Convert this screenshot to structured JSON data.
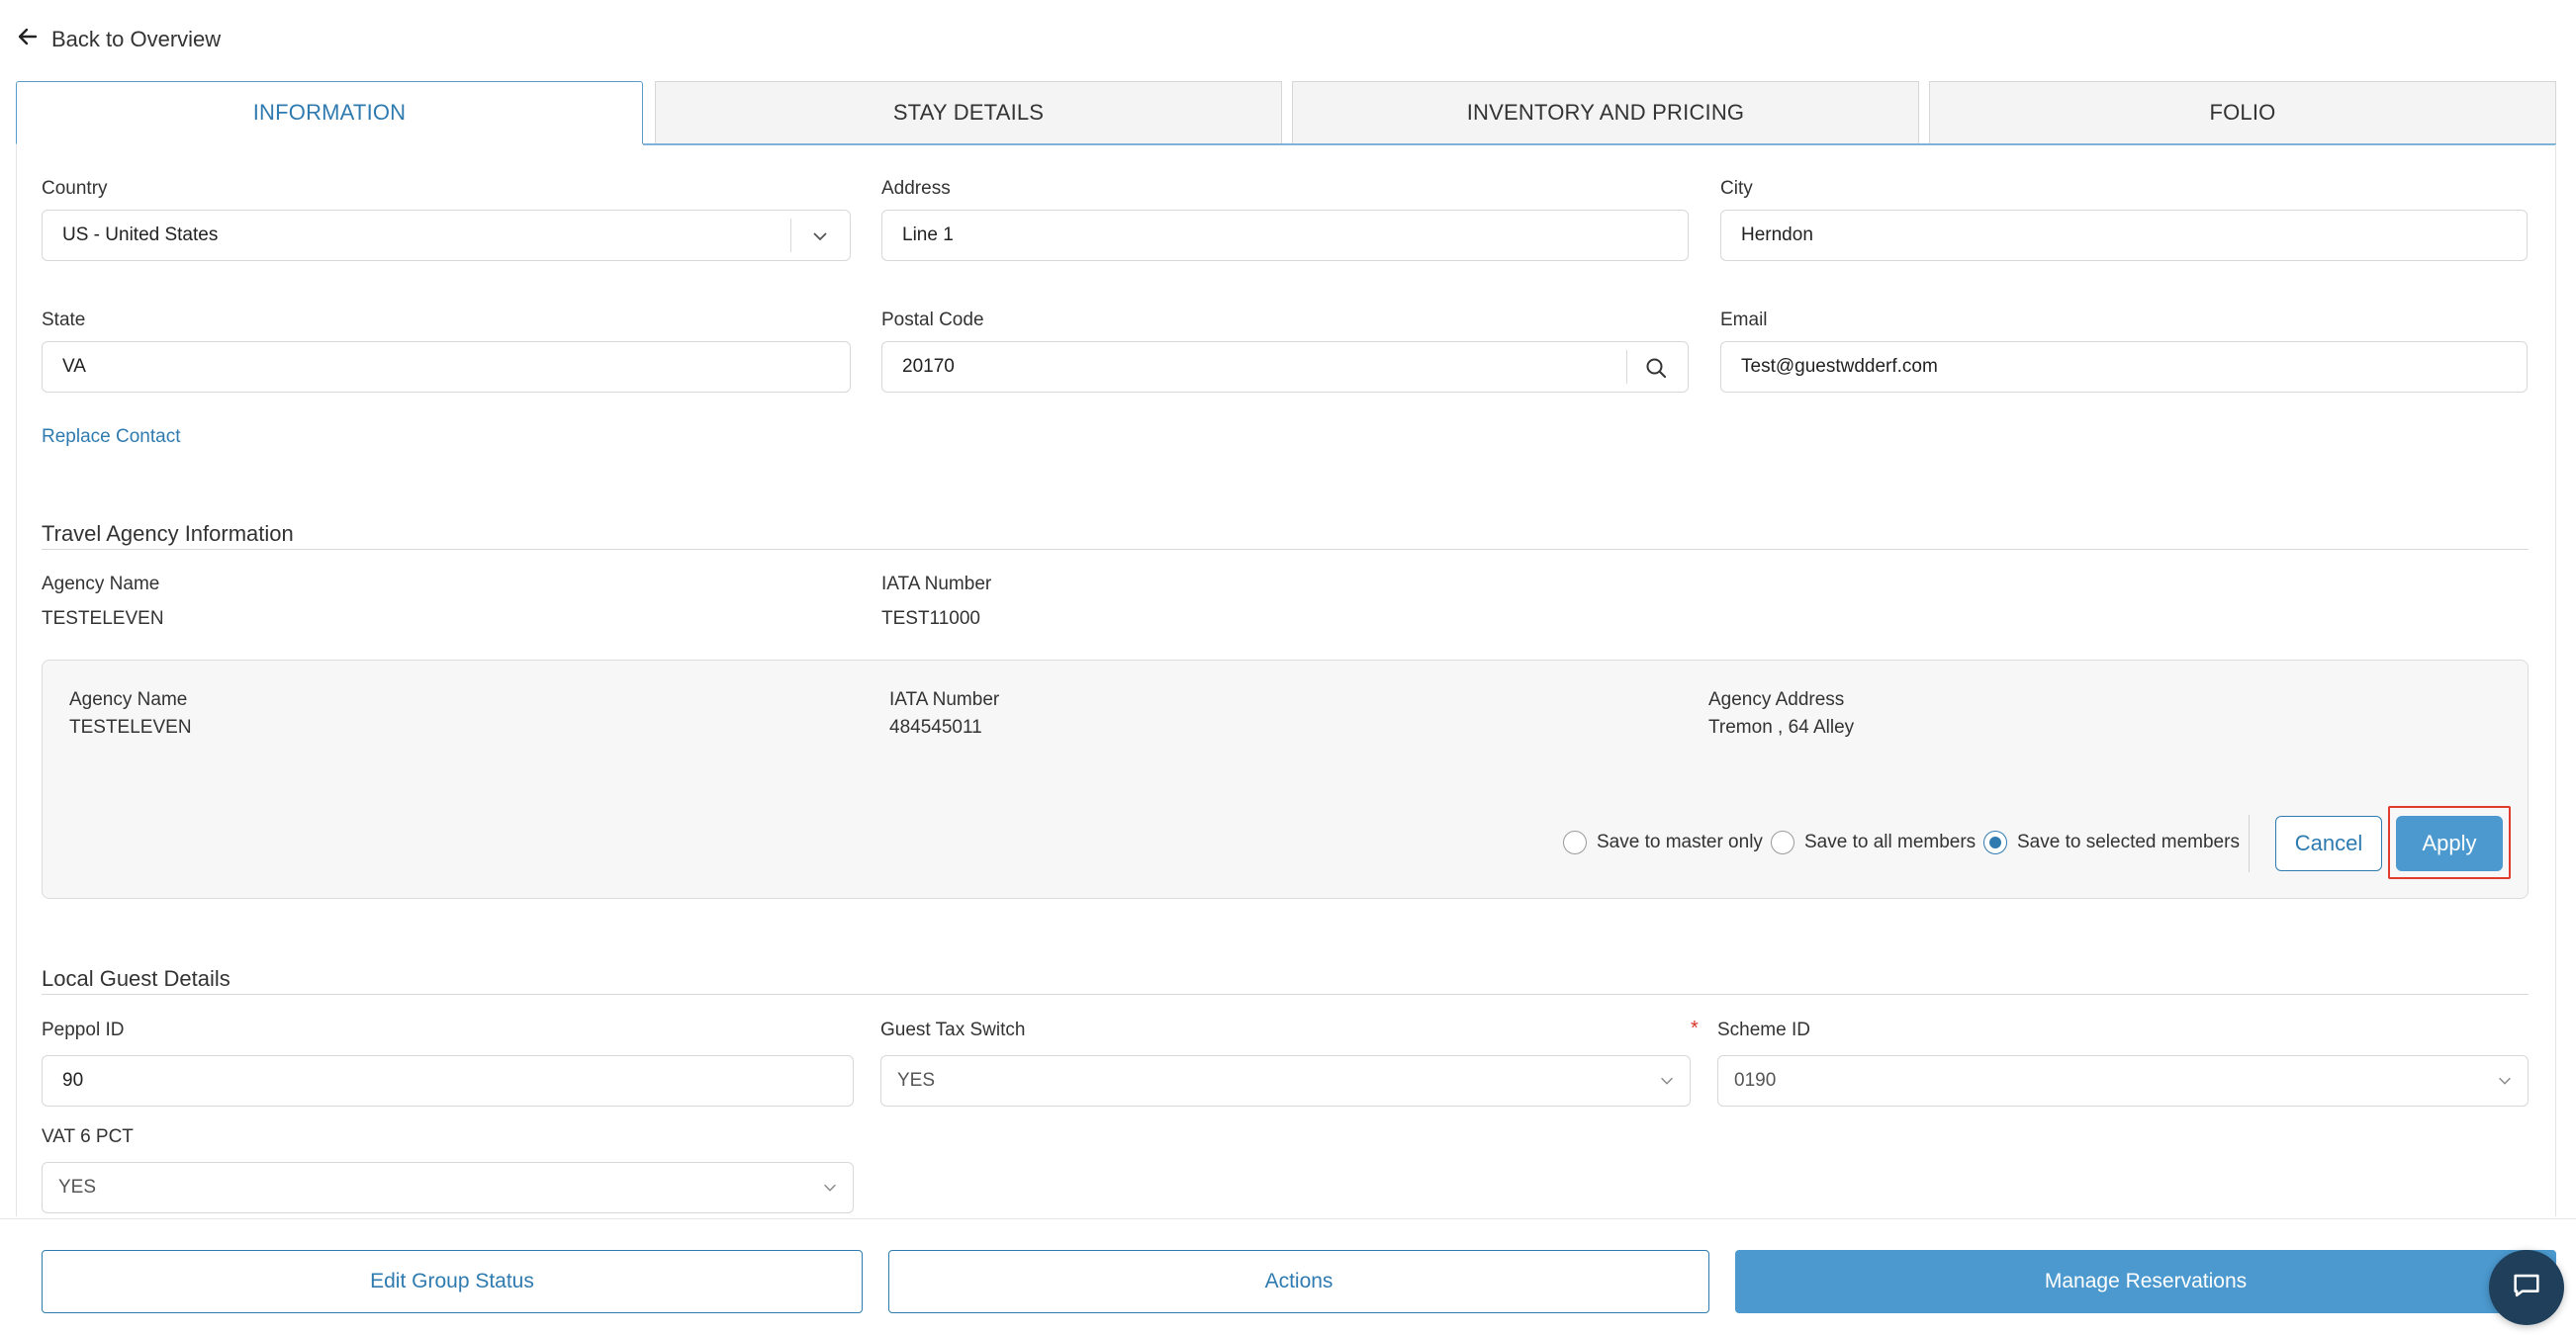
{
  "nav": {
    "back_label": "Back to Overview"
  },
  "tabs": [
    {
      "label": "INFORMATION",
      "active": true
    },
    {
      "label": "STAY DETAILS",
      "active": false
    },
    {
      "label": "INVENTORY AND PRICING",
      "active": false
    },
    {
      "label": "FOLIO",
      "active": false
    }
  ],
  "contact": {
    "country": {
      "label": "Country",
      "value": "US - United States"
    },
    "address": {
      "label": "Address",
      "value": "Line 1"
    },
    "city": {
      "label": "City",
      "value": "Herndon"
    },
    "state": {
      "label": "State",
      "value": "VA"
    },
    "postal_code": {
      "label": "Postal Code",
      "value": "20170"
    },
    "email": {
      "label": "Email",
      "value": "Test@guestwdderf.com"
    },
    "replace_contact": "Replace Contact"
  },
  "travel_agency": {
    "title": "Travel Agency Information",
    "agency_name_label": "Agency Name",
    "agency_name": "TESTELEVEN",
    "iata_label": "IATA Number",
    "iata": "TEST11000",
    "card": {
      "agency_name_label": "Agency Name",
      "agency_name": "TESTELEVEN",
      "iata_label": "IATA Number",
      "iata": "484545011",
      "address_label": "Agency Address",
      "address": "Tremon , 64 Alley"
    },
    "save_options": [
      {
        "label": "Save to master only",
        "selected": false
      },
      {
        "label": "Save to all members",
        "selected": false
      },
      {
        "label": "Save to selected members",
        "selected": true
      }
    ],
    "cancel_label": "Cancel",
    "apply_label": "Apply"
  },
  "local_guest": {
    "title": "Local Guest Details",
    "peppol": {
      "label": "Peppol ID",
      "value": "90"
    },
    "guest_tax": {
      "label": "Guest Tax Switch",
      "value": "YES"
    },
    "scheme": {
      "label": "Scheme ID",
      "required_mark": "*",
      "value": "0190"
    },
    "vat": {
      "label": "VAT 6 PCT",
      "value": "YES"
    }
  },
  "footer": {
    "edit_group_status": "Edit Group Status",
    "actions": "Actions",
    "manage_reservations": "Manage Reservations"
  },
  "icons": {
    "back": "arrow-left-icon",
    "dropdown": "chevron-down-icon",
    "search": "search-icon",
    "chat": "chat-icon"
  },
  "colors": {
    "accent": "#2f7bb0",
    "primary_button": "#4b99cf",
    "highlight": "#e23a2e",
    "chat_bg": "#1f3f5b"
  }
}
